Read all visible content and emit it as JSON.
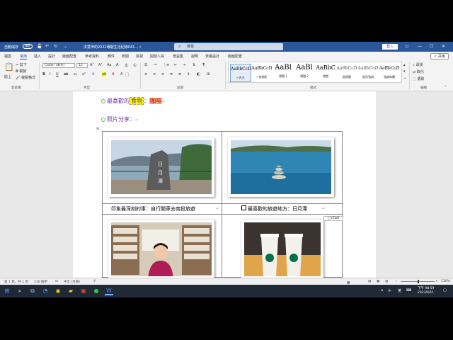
{
  "titlebar": {
    "autosave_label": "自動儲存",
    "autosave_state": "關閉",
    "doc_name": "洪慧萍的2022專觀生活紀錄041... •",
    "search_placeholder": "搜尋",
    "login_label": "登入"
  },
  "tabs": [
    "檔案",
    "常用",
    "插入",
    "設計",
    "版面配置",
    "參考資料",
    "郵件",
    "校閱",
    "檢視",
    "開發人員",
    "增益集",
    "說明",
    "表格設計",
    "版面配置"
  ],
  "active_tab_index": 1,
  "share_label": "共用",
  "ribbon": {
    "clipboard": {
      "paste": "貼上",
      "cut": "剪下",
      "copy": "複製",
      "format_painter": "複製格式",
      "group": "剪貼簿"
    },
    "font": {
      "font_name": "Calibri (本文)",
      "font_size": "12",
      "group": "字型"
    },
    "paragraph": {
      "group": "段落"
    },
    "styles": {
      "group": "樣式",
      "items": [
        {
          "preview": "AaBbCcD",
          "name": "↵內文"
        },
        {
          "preview": "AaBbCcD",
          "name": "↵無間距"
        },
        {
          "preview": "AaBl",
          "name": "標題 1"
        },
        {
          "preview": "AaBl",
          "name": "標題 2"
        },
        {
          "preview": "AaBbC",
          "name": "標題"
        },
        {
          "preview": "AaBbCcD",
          "name": "副標題"
        },
        {
          "preview": "AaBbCcD",
          "name": "區別強調"
        },
        {
          "preview": "AaBbCcD",
          "name": "強調斜體"
        }
      ]
    },
    "editing": {
      "find": "尋找",
      "replace": "取代",
      "select": "選取",
      "group": "編輯"
    }
  },
  "document": {
    "fav_food_label": "最喜歡的",
    "fav_food_highlight": "食物",
    "fav_food_colon": "：",
    "fav_food_value": "咖啡",
    "photo_share_label": "照片分享：",
    "captions": {
      "left_top": "印象最深刻的事：自行開車去南投旅遊",
      "right_top": "最喜歡的旅遊地方：日月潭"
    },
    "ctrl_tag": "(Ctrl)"
  },
  "statusbar": {
    "page": "第 1 頁，共 1 頁",
    "words": "110 個字",
    "language": "中文 (台灣)",
    "focus": "專注",
    "zoom": "130%"
  },
  "taskbar": {
    "time": "下午 08:59",
    "date": "2023/8/11",
    "ime": "英"
  }
}
